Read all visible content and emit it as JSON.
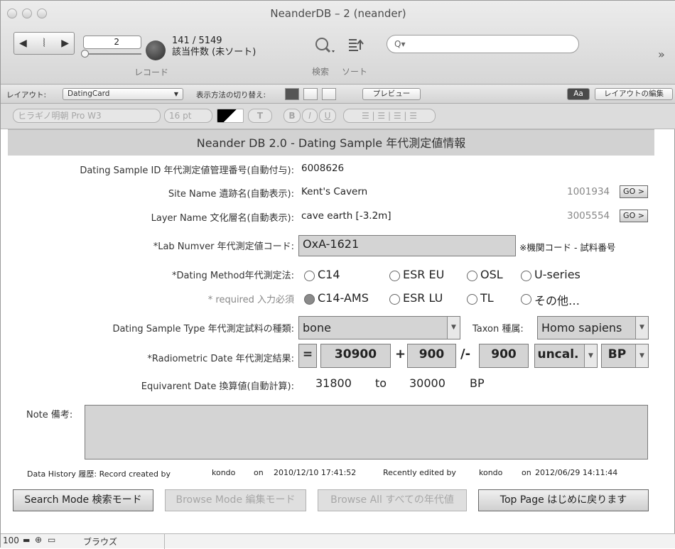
{
  "window": {
    "title": "NeanderDB – 2 (neander)"
  },
  "toolbar": {
    "record_number": "2",
    "found_count": "141 / 5149",
    "sort_status": "該当件数 (未ソート)",
    "records_label": "レコード",
    "search_placeholder": "Q▾",
    "find_label": "検索",
    "sort_label": "ソート",
    "overflow": "»"
  },
  "layout_bar": {
    "layout_label": "レイアウト:",
    "layout_value": "DatingCard",
    "view_as_label": "表示方法の切り替え:",
    "preview_button": "プレビュー",
    "aa_button": "Aa",
    "edit_layout_button": "レイアウトの編集"
  },
  "format_bar": {
    "font": "ヒラギノ明朝 Pro W3",
    "size": "16 pt",
    "style_t": "T",
    "bold": "B",
    "italic": "I",
    "underline": "U"
  },
  "form": {
    "header": "Neander DB 2.0 - Dating Sample 年代測定値情報",
    "sample_id_label": "Dating Sample ID 年代測定値管理番号(自動付与):",
    "sample_id_value": "6008626",
    "site_label": "Site Name 遺跡名(自動表示):",
    "site_value": "Kent's Cavern",
    "site_id": "1001934",
    "layer_label": "Layer Name 文化層名(自動表示):",
    "layer_value": "cave earth [-3.2m]",
    "layer_id": "3005554",
    "go_label": "GO >",
    "lab_label": "*Lab Numver 年代測定値コード:",
    "lab_value": "OxA-1621",
    "lab_hint": "※機関コード - 試料番号",
    "method_label": "*Dating Method年代測定法:",
    "required_label": "* required 入力必須",
    "methods": [
      "C14",
      "ESR EU",
      "OSL",
      "U-series",
      "C14-AMS",
      "ESR LU",
      "TL",
      "その他…"
    ],
    "selected_method": "C14-AMS",
    "sample_type_label": "Dating Sample Type 年代測定試料の種類:",
    "sample_type_value": "bone",
    "taxon_label": "Taxon 種属:",
    "taxon_value": "Homo sapiens",
    "date_label": "*Radiometric Date 年代測定結果:",
    "date_operator": "=",
    "date_value": "30900",
    "plus": "+",
    "plus_error": "900",
    "minus": "/-",
    "minus_error": "900",
    "calibration": "uncal.",
    "unit": "BP",
    "equiv_label": "Equivarent Date 換算値(自動計算):",
    "equiv_from": "31800",
    "equiv_to_word": "to",
    "equiv_to": "30000",
    "equiv_unit": "BP",
    "note_label": "Note 備考:",
    "note_value": "",
    "history": {
      "label": "Data History 履歴: Record created by",
      "created_by": "kondo",
      "on1": "on",
      "created_on": "2010/12/10 17:41:52",
      "edited_label": "Recently edited by",
      "edited_by": "kondo",
      "on2": "on",
      "edited_on": "2012/06/29 14:11:44"
    },
    "buttons": {
      "search_mode": "Search Mode 検索モード",
      "browse_mode": "Browse Mode 編集モード",
      "browse_all": "Browse All すべての年代値",
      "top_page": "Top Page はじめに戻ります"
    }
  },
  "statusbar": {
    "zoom": "100",
    "mode": "ブラウズ"
  }
}
